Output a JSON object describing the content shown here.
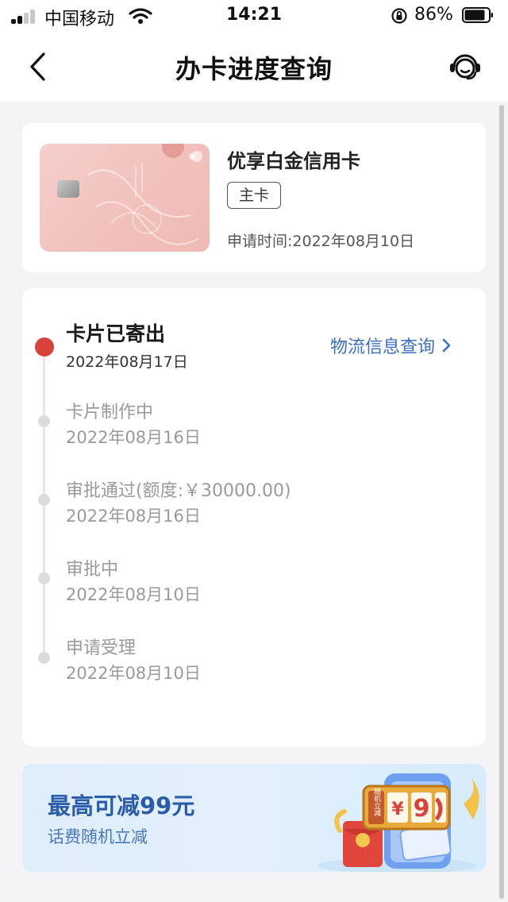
{
  "status_bar": {
    "carrier": "中国移动",
    "time": "14:21",
    "battery_percent": "86%",
    "signal_bars": 4,
    "signal_bars_filled": 2,
    "battery_level": 0.86
  },
  "nav": {
    "title": "办卡进度查询",
    "back_icon": "chevron-left-icon",
    "service_icon": "customer-service-icon"
  },
  "card": {
    "name": "优享白金信用卡",
    "badge": "主卡",
    "apply_time": "申请时间:2022年08月10日"
  },
  "progress": {
    "logistics_link": "物流信息查询",
    "steps": [
      {
        "title": "卡片已寄出",
        "date": "2022年08月17日",
        "state": "current"
      },
      {
        "title": "卡片制作中",
        "date": "2022年08月16日",
        "state": "done"
      },
      {
        "title": "审批通过(额度:￥30000.00)",
        "date": "2022年08月16日",
        "state": "done"
      },
      {
        "title": "审批中",
        "date": "2022年08月10日",
        "state": "done"
      },
      {
        "title": "申请受理",
        "date": "2022年08月10日",
        "state": "done"
      }
    ]
  },
  "promo": {
    "title": "最高可减99元",
    "subtitle": "话费随机立减",
    "art_text": "随机立减",
    "slot_symbol": "¥",
    "slot_digit": "9"
  },
  "colors": {
    "accent_red": "#d9423a",
    "link_blue": "#3b6fc2",
    "promo_blue": "#2a5caa",
    "card_pink": "#f3c5c0"
  }
}
